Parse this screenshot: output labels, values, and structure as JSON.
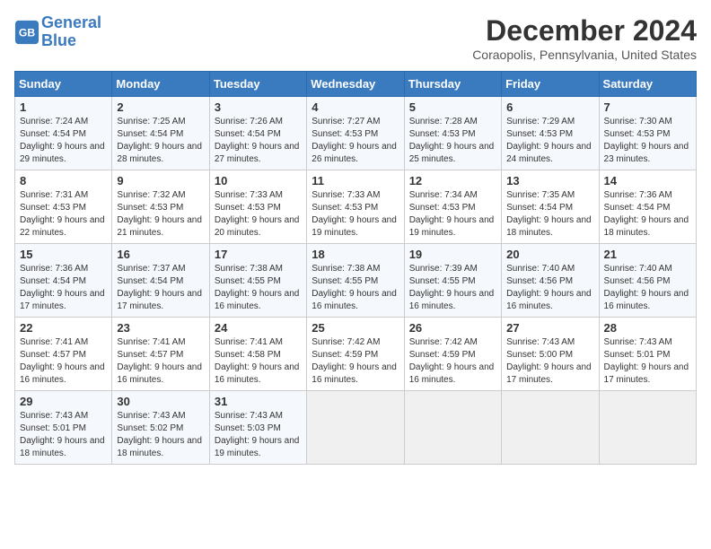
{
  "logo": {
    "line1": "General",
    "line2": "Blue"
  },
  "title": "December 2024",
  "location": "Coraopolis, Pennsylvania, United States",
  "headers": [
    "Sunday",
    "Monday",
    "Tuesday",
    "Wednesday",
    "Thursday",
    "Friday",
    "Saturday"
  ],
  "weeks": [
    [
      {
        "day": "1",
        "sunrise": "7:24 AM",
        "sunset": "4:54 PM",
        "daylight": "9 hours and 29 minutes."
      },
      {
        "day": "2",
        "sunrise": "7:25 AM",
        "sunset": "4:54 PM",
        "daylight": "9 hours and 28 minutes."
      },
      {
        "day": "3",
        "sunrise": "7:26 AM",
        "sunset": "4:54 PM",
        "daylight": "9 hours and 27 minutes."
      },
      {
        "day": "4",
        "sunrise": "7:27 AM",
        "sunset": "4:53 PM",
        "daylight": "9 hours and 26 minutes."
      },
      {
        "day": "5",
        "sunrise": "7:28 AM",
        "sunset": "4:53 PM",
        "daylight": "9 hours and 25 minutes."
      },
      {
        "day": "6",
        "sunrise": "7:29 AM",
        "sunset": "4:53 PM",
        "daylight": "9 hours and 24 minutes."
      },
      {
        "day": "7",
        "sunrise": "7:30 AM",
        "sunset": "4:53 PM",
        "daylight": "9 hours and 23 minutes."
      }
    ],
    [
      {
        "day": "8",
        "sunrise": "7:31 AM",
        "sunset": "4:53 PM",
        "daylight": "9 hours and 22 minutes."
      },
      {
        "day": "9",
        "sunrise": "7:32 AM",
        "sunset": "4:53 PM",
        "daylight": "9 hours and 21 minutes."
      },
      {
        "day": "10",
        "sunrise": "7:33 AM",
        "sunset": "4:53 PM",
        "daylight": "9 hours and 20 minutes."
      },
      {
        "day": "11",
        "sunrise": "7:33 AM",
        "sunset": "4:53 PM",
        "daylight": "9 hours and 19 minutes."
      },
      {
        "day": "12",
        "sunrise": "7:34 AM",
        "sunset": "4:53 PM",
        "daylight": "9 hours and 19 minutes."
      },
      {
        "day": "13",
        "sunrise": "7:35 AM",
        "sunset": "4:54 PM",
        "daylight": "9 hours and 18 minutes."
      },
      {
        "day": "14",
        "sunrise": "7:36 AM",
        "sunset": "4:54 PM",
        "daylight": "9 hours and 18 minutes."
      }
    ],
    [
      {
        "day": "15",
        "sunrise": "7:36 AM",
        "sunset": "4:54 PM",
        "daylight": "9 hours and 17 minutes."
      },
      {
        "day": "16",
        "sunrise": "7:37 AM",
        "sunset": "4:54 PM",
        "daylight": "9 hours and 17 minutes."
      },
      {
        "day": "17",
        "sunrise": "7:38 AM",
        "sunset": "4:55 PM",
        "daylight": "9 hours and 16 minutes."
      },
      {
        "day": "18",
        "sunrise": "7:38 AM",
        "sunset": "4:55 PM",
        "daylight": "9 hours and 16 minutes."
      },
      {
        "day": "19",
        "sunrise": "7:39 AM",
        "sunset": "4:55 PM",
        "daylight": "9 hours and 16 minutes."
      },
      {
        "day": "20",
        "sunrise": "7:40 AM",
        "sunset": "4:56 PM",
        "daylight": "9 hours and 16 minutes."
      },
      {
        "day": "21",
        "sunrise": "7:40 AM",
        "sunset": "4:56 PM",
        "daylight": "9 hours and 16 minutes."
      }
    ],
    [
      {
        "day": "22",
        "sunrise": "7:41 AM",
        "sunset": "4:57 PM",
        "daylight": "9 hours and 16 minutes."
      },
      {
        "day": "23",
        "sunrise": "7:41 AM",
        "sunset": "4:57 PM",
        "daylight": "9 hours and 16 minutes."
      },
      {
        "day": "24",
        "sunrise": "7:41 AM",
        "sunset": "4:58 PM",
        "daylight": "9 hours and 16 minutes."
      },
      {
        "day": "25",
        "sunrise": "7:42 AM",
        "sunset": "4:59 PM",
        "daylight": "9 hours and 16 minutes."
      },
      {
        "day": "26",
        "sunrise": "7:42 AM",
        "sunset": "4:59 PM",
        "daylight": "9 hours and 16 minutes."
      },
      {
        "day": "27",
        "sunrise": "7:43 AM",
        "sunset": "5:00 PM",
        "daylight": "9 hours and 17 minutes."
      },
      {
        "day": "28",
        "sunrise": "7:43 AM",
        "sunset": "5:01 PM",
        "daylight": "9 hours and 17 minutes."
      }
    ],
    [
      {
        "day": "29",
        "sunrise": "7:43 AM",
        "sunset": "5:01 PM",
        "daylight": "9 hours and 18 minutes."
      },
      {
        "day": "30",
        "sunrise": "7:43 AM",
        "sunset": "5:02 PM",
        "daylight": "9 hours and 18 minutes."
      },
      {
        "day": "31",
        "sunrise": "7:43 AM",
        "sunset": "5:03 PM",
        "daylight": "9 hours and 19 minutes."
      },
      null,
      null,
      null,
      null
    ]
  ]
}
